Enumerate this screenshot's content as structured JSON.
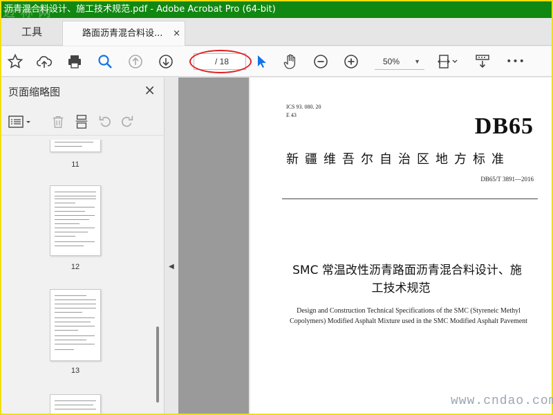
{
  "window": {
    "title": "沥青混合料设计、施工技术规范.pdf - Adobe Acrobat Pro (64-bit)",
    "watermark_top": "迈 称 网"
  },
  "tabs": {
    "tools_label": "工具",
    "document_label": "路面沥青混合料设...",
    "close_glyph": "×"
  },
  "toolbar": {
    "icons": [
      "star-icon",
      "cloud-upload-icon",
      "printer-icon",
      "search-icon",
      "page-up-icon",
      "page-down-icon",
      "select-arrow-icon",
      "hand-icon",
      "zoom-out-icon",
      "zoom-in-icon",
      "fit-page-icon",
      "scroll-mode-icon",
      "more-icon"
    ],
    "page_total": "/ 18",
    "zoom_value": "50%",
    "more_glyph": "•••"
  },
  "sidebar": {
    "title": "页面缩略图",
    "close_glyph": "×",
    "thumbnails": [
      {
        "label": "11"
      },
      {
        "label": "12"
      },
      {
        "label": "13"
      }
    ]
  },
  "document": {
    "ics_line": "ICS  93. 080. 20",
    "classification": "E 43",
    "db_code": "DB65",
    "standard_name": "新疆维吾尔自治区地方标准",
    "standard_number": "DB65/T 3891—2016",
    "title_cn_line1": "SMC 常温改性沥青路面沥青混合料设计、施",
    "title_cn_line2": "工技术规范",
    "title_en": "Design and Construction Technical Specifications of the SMC (Styreneic Methyl Copolymers) Modified Asphalt Mixture used in the SMC Modified Asphalt Pavement"
  },
  "watermark_bottom": "www.cndao.com",
  "colors": {
    "titlebar": "#118811",
    "highlight_oval": "#e02020",
    "accent_blue": "#1473e6"
  }
}
